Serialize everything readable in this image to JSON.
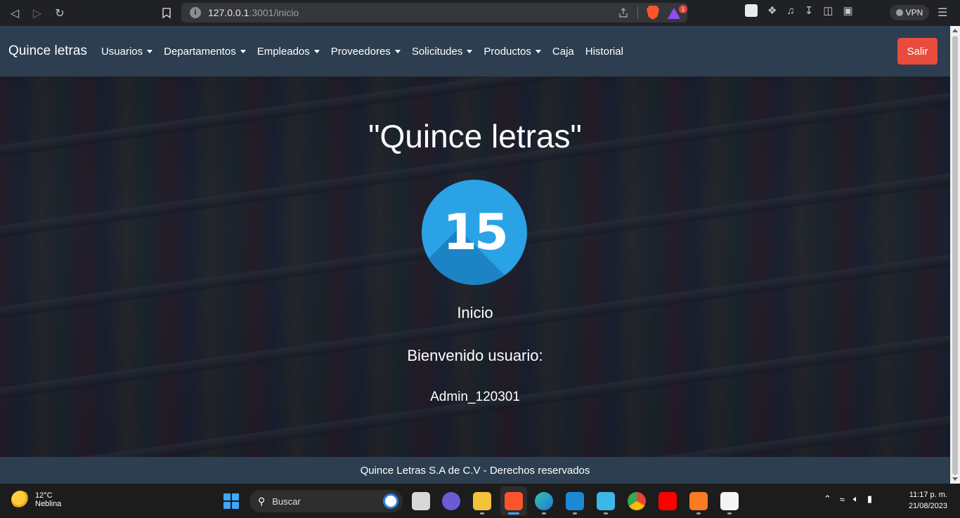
{
  "browser": {
    "url_host": "127.0.0.1",
    "url_path": ":3001/inicio",
    "alert_badge": "1",
    "vpn_label": "VPN"
  },
  "navbar": {
    "brand": "Quince letras",
    "items": [
      {
        "label": "Usuarios",
        "dropdown": true
      },
      {
        "label": "Departamentos",
        "dropdown": true
      },
      {
        "label": "Empleados",
        "dropdown": true
      },
      {
        "label": "Proveedores",
        "dropdown": true
      },
      {
        "label": "Solicitudes",
        "dropdown": true
      },
      {
        "label": "Productos",
        "dropdown": true
      },
      {
        "label": "Caja",
        "dropdown": false
      },
      {
        "label": "Historial",
        "dropdown": false
      }
    ],
    "logout_label": "Salir",
    "logout_color": "#e74c3c",
    "bar_color": "#2c3e50"
  },
  "hero": {
    "title": "\"Quince letras\"",
    "logo_number": "15",
    "logo_color": "#2aa3e6",
    "page_name": "Inicio",
    "welcome": "Bienvenido usuario:",
    "username": "Admin_120301"
  },
  "footer": {
    "text": "Quince Letras S.A de C.V - Derechos reservados"
  },
  "taskbar": {
    "weather_temp": "12°C",
    "weather_desc": "Neblina",
    "search_placeholder": "Buscar",
    "time": "11:17 p. m.",
    "date": "21/08/2023",
    "apps": [
      "start-icon",
      "task-view-icon",
      "teams-icon",
      "file-explorer-icon",
      "brave-icon",
      "edge-icon",
      "vscode-icon",
      "notepad-icon",
      "chrome-icon",
      "youtube-icon",
      "xampp-icon",
      "paint-icon"
    ]
  }
}
